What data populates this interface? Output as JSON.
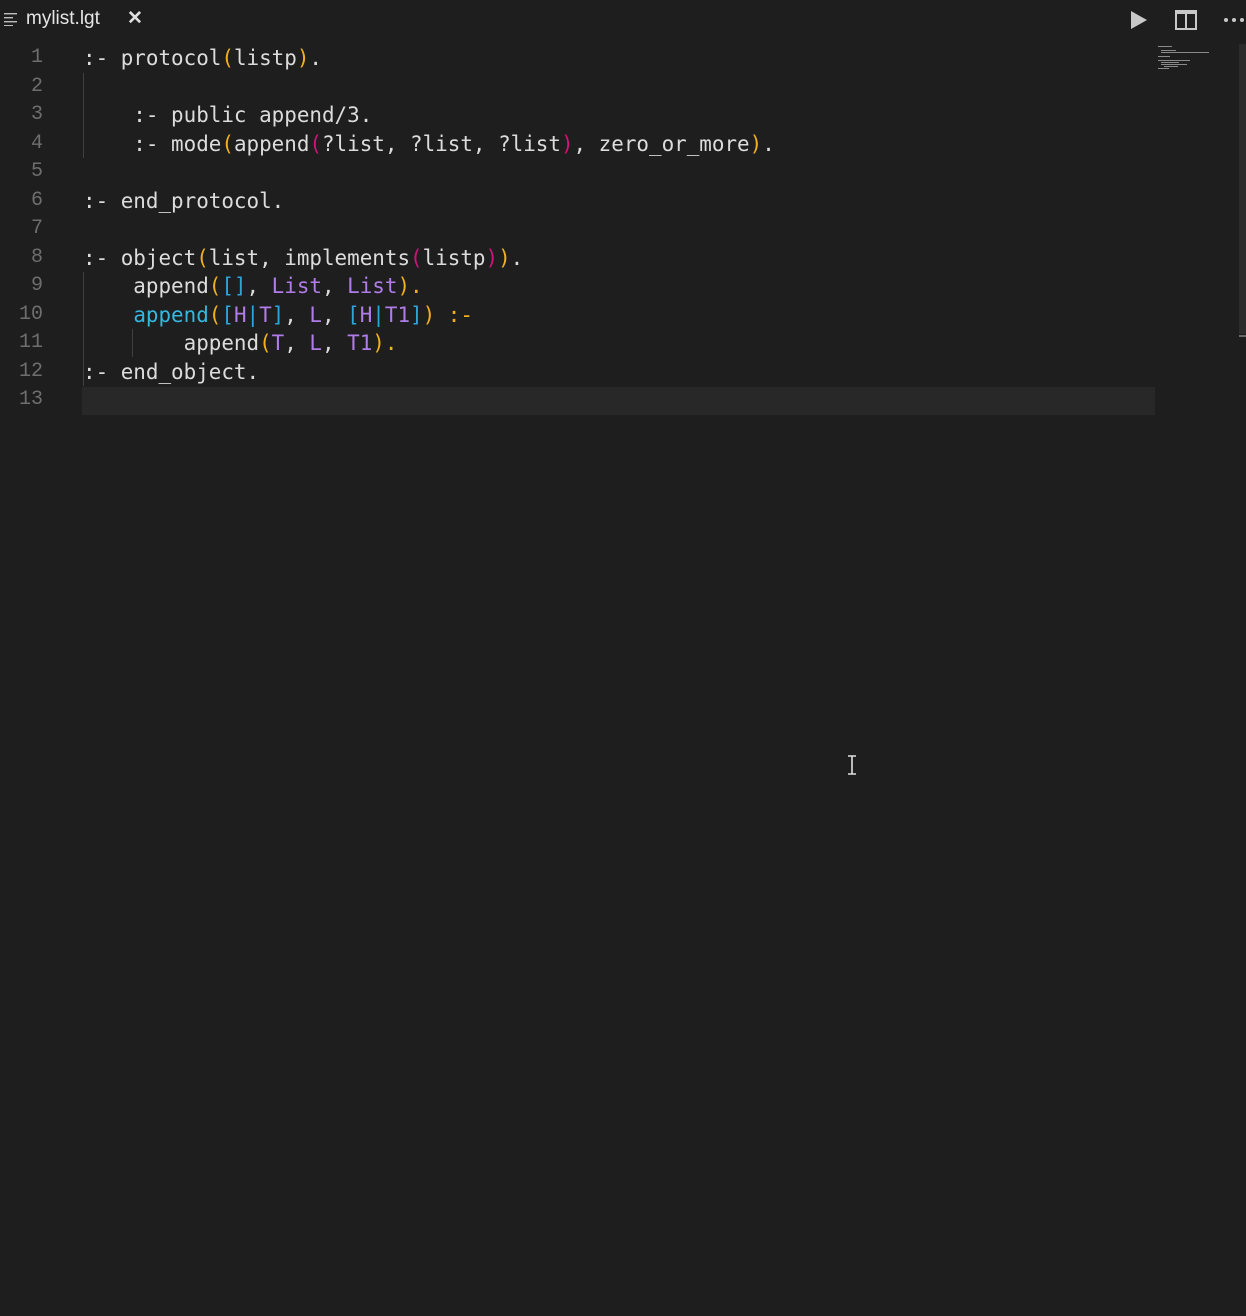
{
  "tab": {
    "title": "mylist.lgt",
    "close_glyph": "✕",
    "icon": "lines-icon"
  },
  "actions": {
    "run": "run-icon",
    "split": "split-editor-icon",
    "more": "more-actions-icon"
  },
  "editor": {
    "line_numbers": [
      "1",
      "2",
      "3",
      "4",
      "5",
      "6",
      "7",
      "8",
      "9",
      "10",
      "11",
      "12",
      "13"
    ],
    "lines": [
      [
        {
          "t": ":- protocol",
          "c": "c-id"
        },
        {
          "t": "(",
          "c": "c-br1"
        },
        {
          "t": "listp",
          "c": "c-id"
        },
        {
          "t": ")",
          "c": "c-br1"
        },
        {
          "t": ".",
          "c": "c-id"
        }
      ],
      [],
      [
        {
          "t": "    :- public append/3.",
          "c": "c-id"
        }
      ],
      [
        {
          "t": "    :- mode",
          "c": "c-id"
        },
        {
          "t": "(",
          "c": "c-br1"
        },
        {
          "t": "append",
          "c": "c-id"
        },
        {
          "t": "(",
          "c": "c-br2"
        },
        {
          "t": "?list, ?list, ?list",
          "c": "c-id"
        },
        {
          "t": ")",
          "c": "c-br2"
        },
        {
          "t": ", zero_or_more",
          "c": "c-id"
        },
        {
          "t": ")",
          "c": "c-br1"
        },
        {
          "t": ".",
          "c": "c-id"
        }
      ],
      [],
      [
        {
          "t": ":- end_protocol.",
          "c": "c-id"
        }
      ],
      [],
      [
        {
          "t": ":- object",
          "c": "c-id"
        },
        {
          "t": "(",
          "c": "c-br1"
        },
        {
          "t": "list, implements",
          "c": "c-id"
        },
        {
          "t": "(",
          "c": "c-br2"
        },
        {
          "t": "listp",
          "c": "c-id"
        },
        {
          "t": ")",
          "c": "c-br2"
        },
        {
          "t": ")",
          "c": "c-br1"
        },
        {
          "t": ".",
          "c": "c-id"
        }
      ],
      [
        {
          "t": "    append",
          "c": "c-id"
        },
        {
          "t": "(",
          "c": "c-br1"
        },
        {
          "t": "[]",
          "c": "c-br3"
        },
        {
          "t": ", ",
          "c": "c-id"
        },
        {
          "t": "List",
          "c": "c-var"
        },
        {
          "t": ", ",
          "c": "c-id"
        },
        {
          "t": "List",
          "c": "c-var"
        },
        {
          "t": ").",
          "c": "c-br1"
        }
      ],
      [
        {
          "t": "    ",
          "c": "c-id"
        },
        {
          "t": "append",
          "c": "c-fn"
        },
        {
          "t": "(",
          "c": "c-br1"
        },
        {
          "t": "[",
          "c": "c-br3"
        },
        {
          "t": "H",
          "c": "c-var"
        },
        {
          "t": "|",
          "c": "c-br3"
        },
        {
          "t": "T",
          "c": "c-var"
        },
        {
          "t": "]",
          "c": "c-br3"
        },
        {
          "t": ", ",
          "c": "c-id"
        },
        {
          "t": "L",
          "c": "c-var"
        },
        {
          "t": ", ",
          "c": "c-id"
        },
        {
          "t": "[",
          "c": "c-br3"
        },
        {
          "t": "H",
          "c": "c-var"
        },
        {
          "t": "|",
          "c": "c-br3"
        },
        {
          "t": "T1",
          "c": "c-var"
        },
        {
          "t": "]",
          "c": "c-br3"
        },
        {
          "t": ")",
          "c": "c-br1"
        },
        {
          "t": " :-",
          "c": "c-br1"
        }
      ],
      [
        {
          "t": "        append",
          "c": "c-id"
        },
        {
          "t": "(",
          "c": "c-br1"
        },
        {
          "t": "T",
          "c": "c-var"
        },
        {
          "t": ", ",
          "c": "c-id"
        },
        {
          "t": "L",
          "c": "c-var"
        },
        {
          "t": ", ",
          "c": "c-id"
        },
        {
          "t": "T1",
          "c": "c-var"
        },
        {
          "t": ").",
          "c": "c-br1"
        }
      ],
      [
        {
          "t": ":- end_object.",
          "c": "c-id"
        }
      ],
      []
    ]
  }
}
